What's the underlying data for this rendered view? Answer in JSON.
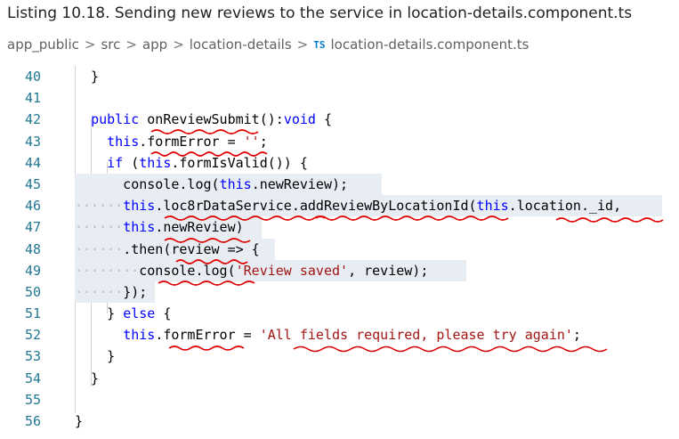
{
  "caption": "Listing 10.18. Sending new reviews to the service in location-details.component.ts",
  "breadcrumb": {
    "items": [
      "app_public",
      "src",
      "app",
      "location-details"
    ],
    "separator": ">",
    "file_icon": "TS",
    "file": "location-details.component.ts"
  },
  "code": {
    "line_numbers": [
      "40",
      "41",
      "42",
      "43",
      "44",
      "45",
      "46",
      "47",
      "48",
      "49",
      "50",
      "51",
      "52",
      "53",
      "54",
      "55",
      "56"
    ],
    "colors": {
      "keyword": "#0000ff",
      "string": "#a31515",
      "line_number": "#237893",
      "highlight": "#e8ecf3",
      "squiggle": "#e00000"
    },
    "lines": [
      [
        {
          "t": "  }"
        }
      ],
      [
        {
          "t": ""
        }
      ],
      [
        {
          "t": "  "
        },
        {
          "t": "public",
          "c": "kw"
        },
        {
          "t": " onReviewSubmit():"
        },
        {
          "t": "void",
          "c": "kw"
        },
        {
          "t": " {"
        }
      ],
      [
        {
          "t": "    "
        },
        {
          "t": "this",
          "c": "kw"
        },
        {
          "t": ".formError = "
        },
        {
          "t": "''",
          "c": "str"
        },
        {
          "t": ";"
        }
      ],
      [
        {
          "t": "    "
        },
        {
          "t": "if",
          "c": "kw"
        },
        {
          "t": " ("
        },
        {
          "t": "this",
          "c": "kw"
        },
        {
          "t": ".formIsValid()) {"
        }
      ],
      [
        {
          "t": "      console.log("
        },
        {
          "t": "this",
          "c": "kw"
        },
        {
          "t": ".newReview);"
        }
      ],
      [
        {
          "t": "······",
          "c": "dots"
        },
        {
          "t": "this",
          "c": "kw"
        },
        {
          "t": ".loc8rDataService.addReviewByLocationId("
        },
        {
          "t": "this",
          "c": "kw"
        },
        {
          "t": ".location._id,"
        }
      ],
      [
        {
          "t": "······",
          "c": "dots"
        },
        {
          "t": "this",
          "c": "kw"
        },
        {
          "t": ".newReview)"
        }
      ],
      [
        {
          "t": "······",
          "c": "dots"
        },
        {
          "t": ".then(review => {"
        }
      ],
      [
        {
          "t": "········",
          "c": "dots"
        },
        {
          "t": "console.log("
        },
        {
          "t": "'Review saved'",
          "c": "str"
        },
        {
          "t": ", review);"
        }
      ],
      [
        {
          "t": "······",
          "c": "dots"
        },
        {
          "t": "});"
        }
      ],
      [
        {
          "t": "    } "
        },
        {
          "t": "else",
          "c": "kw"
        },
        {
          "t": " {"
        }
      ],
      [
        {
          "t": "      "
        },
        {
          "t": "this",
          "c": "kw"
        },
        {
          "t": ".formError = "
        },
        {
          "t": "'All fields required, please try again'",
          "c": "str"
        },
        {
          "t": ";"
        }
      ],
      [
        {
          "t": "    }"
        }
      ],
      [
        {
          "t": "  }"
        }
      ],
      [
        {
          "t": ""
        }
      ],
      [
        {
          "t": "}"
        }
      ]
    ]
  }
}
